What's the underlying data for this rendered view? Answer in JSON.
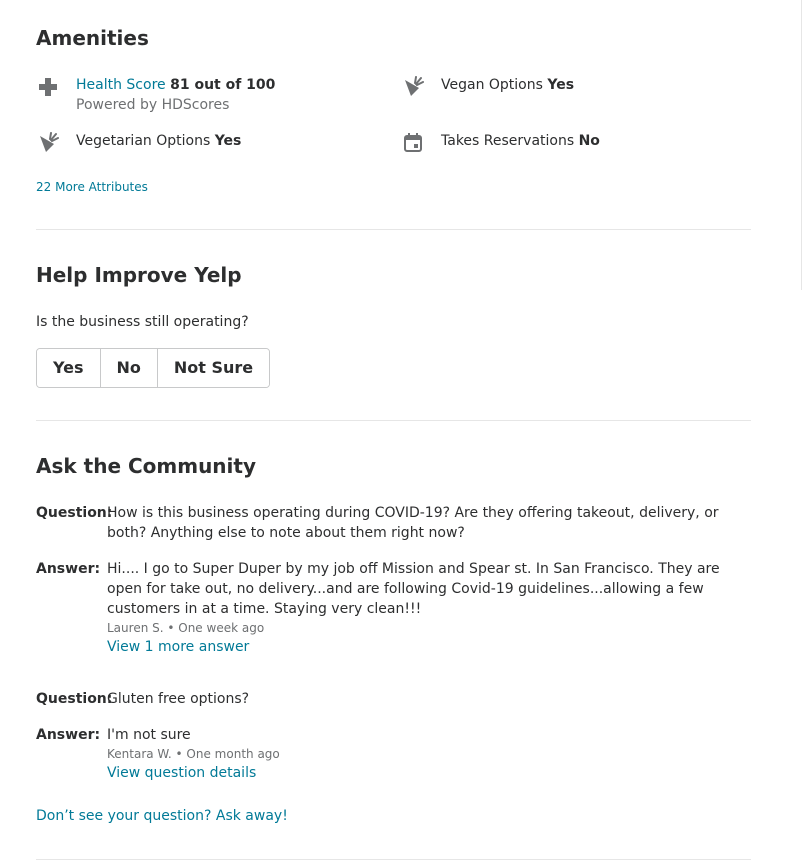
{
  "amenities": {
    "title": "Amenities",
    "health": {
      "label": "Health Score",
      "value": "81 out of 100",
      "sub": "Powered by HDScores"
    },
    "vegan": {
      "label": "Vegan Options",
      "value": "Yes"
    },
    "vegetarian": {
      "label": "Vegetarian Options",
      "value": "Yes"
    },
    "reservations": {
      "label": "Takes Reservations",
      "value": "No"
    },
    "more_link": "22 More Attributes",
    "icons": [
      "plus-icon",
      "carrot-icon",
      "carrot-icon",
      "calendar-icon"
    ]
  },
  "help": {
    "title": "Help Improve Yelp",
    "prompt": "Is the business still operating?",
    "buttons": [
      "Yes",
      "No",
      "Not Sure"
    ]
  },
  "community": {
    "title": "Ask the Community",
    "question_label": "Question:",
    "answer_label": "Answer:",
    "items": [
      {
        "question": "How is this business operating during COVID-19? Are they offering takeout, delivery, or both? Anything else to note about them right now?",
        "answer": "Hi.... I go to Super Duper by my job off Mission and Spear st. In San Francisco. They are open for take out, no delivery...and are following Covid-19 guidelines...allowing a few customers in at a time. Staying very clean!!!",
        "meta": "Lauren S. • One week ago",
        "link": "View 1 more answer"
      },
      {
        "question": "Gluten free options?",
        "answer": "I'm not sure",
        "meta": "Kentara W. • One month ago",
        "link": "View question details"
      }
    ],
    "ask_link": "Don’t see your question? Ask away!"
  },
  "colors": {
    "link": "#027a97",
    "text": "#2d2e2f",
    "muted": "#6e7072",
    "icon": "#6e7072"
  }
}
